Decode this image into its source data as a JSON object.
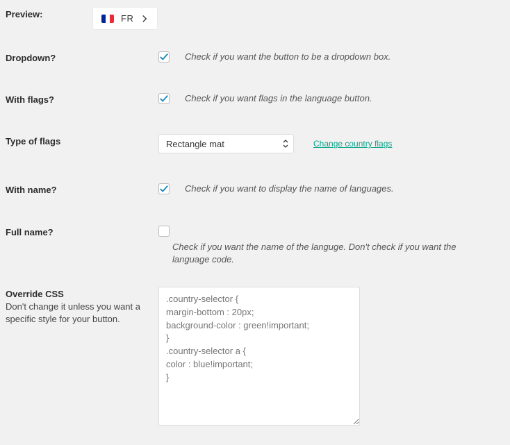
{
  "preview": {
    "label": "Preview:",
    "flag_code": "FR"
  },
  "dropdown": {
    "label": "Dropdown?",
    "help": "Check if you want the button to be a dropdown box."
  },
  "with_flags": {
    "label": "With flags?",
    "help": "Check if you want flags in the language button."
  },
  "type_of_flags": {
    "label": "Type of flags",
    "selected": "Rectangle mat",
    "link": "Change country flags"
  },
  "with_name": {
    "label": "With name?",
    "help": "Check if you want to display the name of languages."
  },
  "full_name": {
    "label": "Full name?",
    "help": "Check if you want the name of the languge. Don't check if you want the language code."
  },
  "override_css": {
    "label": "Override CSS",
    "sublabel": "Don't change it unless you want a specific style for your button.",
    "placeholder": ".country-selector {\nmargin-bottom : 20px;\nbackground-color : green!important;\n}\n.country-selector a {\ncolor : blue!important;\n}"
  }
}
